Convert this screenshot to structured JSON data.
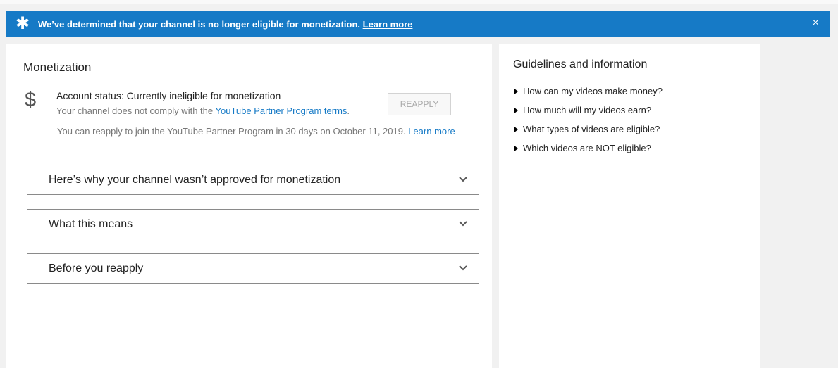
{
  "banner": {
    "icon": "star-icon",
    "message": "We’ve determined that your channel is no longer eligible for monetization.",
    "link_label": "Learn more",
    "close_glyph": "×",
    "background_color": "#167ac6"
  },
  "main": {
    "title": "Monetization",
    "status_icon_glyph": "$",
    "status_line": "Account status: Currently ineligible for monetization",
    "status_sub_text": "Your channel does not comply with the",
    "status_sub_link": "YouTube Partner Program terms",
    "status_sub_period": ".",
    "reapply_button": "REAPPLY",
    "reapply_note": "You can reapply to join the YouTube Partner Program in 30 days on October 11, 2019.",
    "reapply_note_link": "Learn more",
    "link_color": "#167ac6"
  },
  "accordions": [
    {
      "label": "Here’s why your channel wasn’t approved for monetization"
    },
    {
      "label": "What this means"
    },
    {
      "label": "Before you reapply"
    }
  ],
  "sidebar": {
    "title": "Guidelines and information",
    "items": [
      {
        "label": "How can my videos make money?"
      },
      {
        "label": "How much will my videos earn?"
      },
      {
        "label": "What types of videos are eligible?"
      },
      {
        "label": "Which videos are NOT eligible?"
      }
    ]
  }
}
